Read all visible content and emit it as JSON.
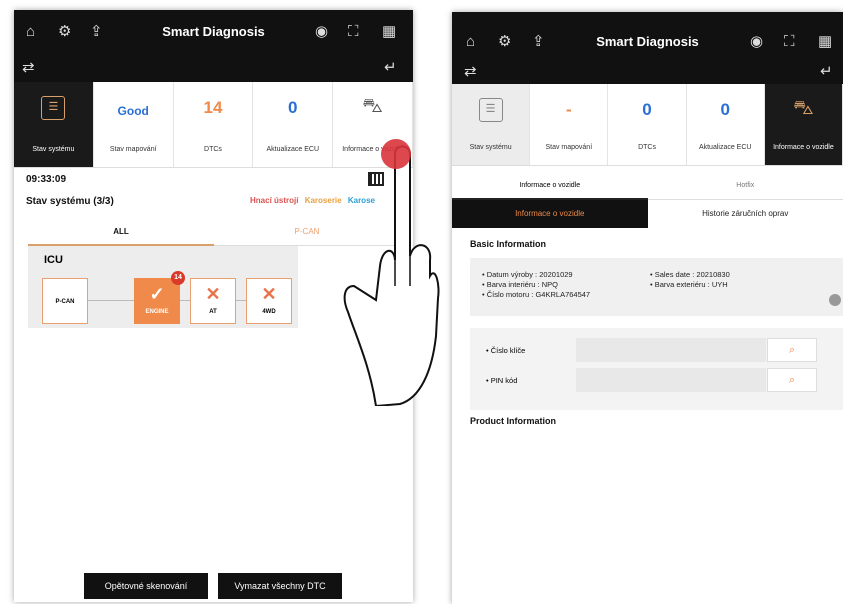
{
  "left": {
    "app_title": "Smart Diagnosis",
    "icons": [
      "home-icon",
      "settings-gear-icon",
      "upload-icon",
      "vci-status-icon",
      "fullscreen-icon",
      "qr-icon",
      "car-link-icon",
      "return-icon"
    ],
    "tiles": [
      {
        "value": "",
        "label": "Stav systému"
      },
      {
        "value": "Good",
        "label": "Stav mapování"
      },
      {
        "value": "14",
        "label": "DTCs"
      },
      {
        "value": "0",
        "label": "Aktualizace ECU"
      },
      {
        "value": "",
        "label": "Informace o vozidle"
      }
    ],
    "time": "09:33:09",
    "system_status": "Stav systému (3/3)",
    "filters": [
      "Hnací ústrojí",
      "Karoserie",
      "Karose"
    ],
    "tabs": [
      "ALL",
      "P-CAN"
    ],
    "icu": {
      "label": "ICU",
      "nodes": [
        {
          "label": "P-CAN"
        },
        {
          "label": "ENGINE",
          "badge": "14"
        },
        {
          "label": "AT"
        },
        {
          "label": "4WD"
        }
      ]
    },
    "buttons": {
      "rescan": "Opětovné skenování",
      "clear_dtc": "Vymazat všechny DTC"
    }
  },
  "right": {
    "app_title": "Smart Diagnosis",
    "tiles": [
      {
        "value": "",
        "label": "Stav systému"
      },
      {
        "value": "-",
        "label": "Stav mapování"
      },
      {
        "value": "0",
        "label": "DTCs"
      },
      {
        "value": "0",
        "label": "Aktualizace ECU"
      },
      {
        "value": "",
        "label": "Informace o vozidle"
      }
    ],
    "tabs": [
      "Informace o vozidle",
      "Hotfix"
    ],
    "subtabs": [
      "Informace o vozidle",
      "Historie záručních oprav"
    ],
    "basic_info_title": "Basic Information",
    "basic_info": {
      "datum_vyroby": "• Datum výroby : 20201029",
      "barva_interieru": "• Barva interiéru : NPQ",
      "cislo_motoru": "• Číslo motoru : G4KRLA764547",
      "sales_date": "• Sales date : 20210830",
      "barva_exterieru": "• Barva exteriéru : UYH"
    },
    "fields": [
      {
        "label": "• Číslo klíče",
        "value": ""
      },
      {
        "label": "• PIN kód",
        "value": ""
      }
    ],
    "product_info_title": "Product Information"
  },
  "colors": {
    "accent": "#f08a4a",
    "dark": "#111111",
    "badge": "#d93a2a",
    "good": "#2a6fd6",
    "dtc": "#f08a4a"
  }
}
